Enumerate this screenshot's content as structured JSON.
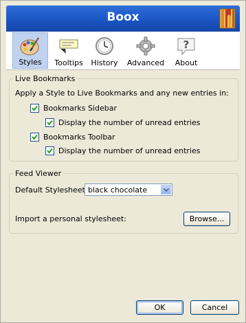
{
  "header": {
    "title": "Boox",
    "logo_icon": "bookmarks-icon"
  },
  "toolbar": {
    "tabs": [
      {
        "label": "Styles",
        "icon": "palette-icon",
        "selected": true
      },
      {
        "label": "Tooltips",
        "icon": "tooltip-icon",
        "selected": false
      },
      {
        "label": "History",
        "icon": "clock-icon",
        "selected": false
      },
      {
        "label": "Advanced",
        "icon": "gear-icon",
        "selected": false
      },
      {
        "label": "About",
        "icon": "help-icon",
        "selected": false
      }
    ]
  },
  "live_bookmarks": {
    "legend": "Live Bookmarks",
    "description": "Apply a Style to Live Bookmarks and any new entries in:",
    "sidebar": {
      "label": "Bookmarks Sidebar",
      "checked": true
    },
    "sidebar_unread": {
      "label": "Display the number of unread entries",
      "checked": true
    },
    "toolbar": {
      "label": "Bookmarks Toolbar",
      "checked": true
    },
    "toolbar_unread": {
      "label": "Display the number of unread entries",
      "checked": true
    }
  },
  "feed_viewer": {
    "legend": "Feed Viewer",
    "stylesheet_label": "Default Stylesheet:",
    "stylesheet_value": "black chocolate",
    "import_label": "Import a personal stylesheet:",
    "browse_label": "Browse..."
  },
  "buttons": {
    "ok": "OK",
    "cancel": "Cancel"
  },
  "colors": {
    "header": "#1a55c4",
    "selected_tab": "#c1d2ee",
    "dialog_bg": "#ece9d8"
  }
}
